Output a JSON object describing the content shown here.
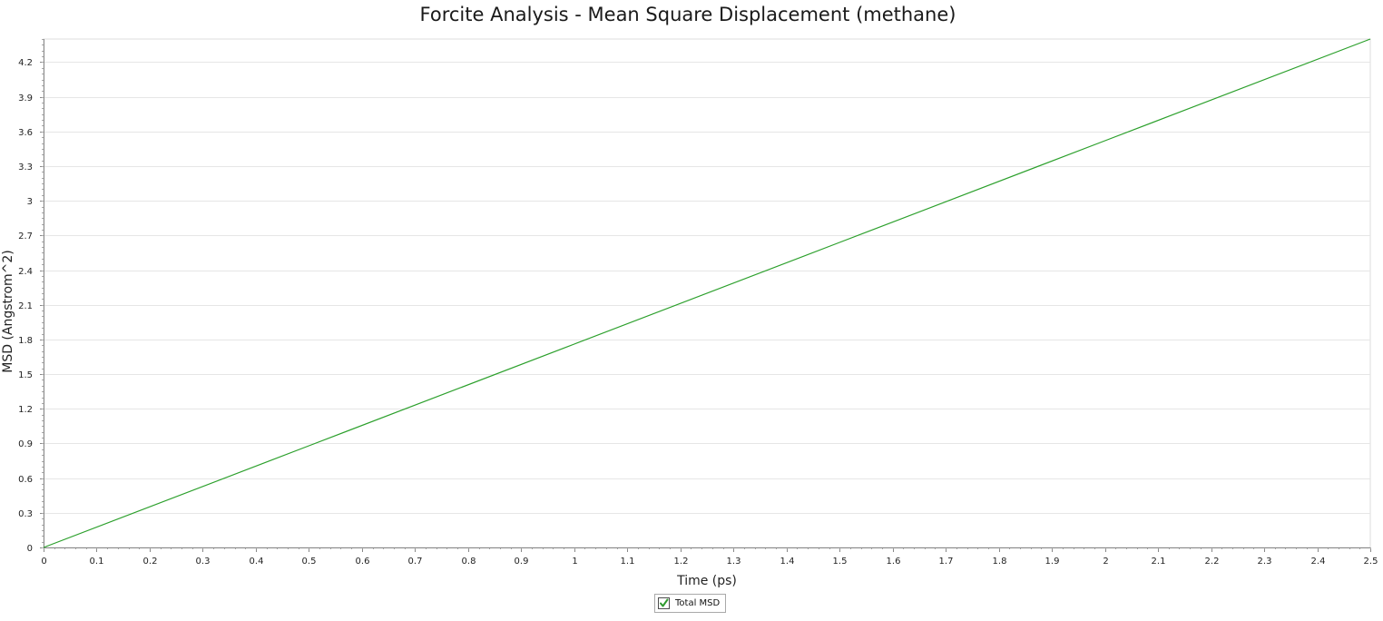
{
  "chart_data": {
    "type": "line",
    "title": "Forcite Analysis - Mean Square Displacement (methane)",
    "xlabel": "Time (ps)",
    "ylabel": "MSD (Angstrom^2)",
    "xlim": [
      0,
      2.5
    ],
    "ylim": [
      0,
      4.4
    ],
    "x_ticks": [
      "0",
      "0.1",
      "0.2",
      "0.3",
      "0.4",
      "0.5",
      "0.6",
      "0.7",
      "0.8",
      "0.9",
      "1",
      "1.1",
      "1.2",
      "1.3",
      "1.4",
      "1.5",
      "1.6",
      "1.7",
      "1.8",
      "1.9",
      "2",
      "2.1",
      "2.2",
      "2.3",
      "2.4",
      "2.5"
    ],
    "y_ticks": [
      "0",
      "0.3",
      "0.6",
      "0.9",
      "1.2",
      "1.5",
      "1.8",
      "2.1",
      "2.4",
      "2.7",
      "3",
      "3.3",
      "3.6",
      "3.9",
      "4.2"
    ],
    "grid": true,
    "legend_position": "bottom-center",
    "series": [
      {
        "name": "Total MSD",
        "color": "#2ca02c",
        "x": [
          0,
          0.5,
          1.0,
          1.5,
          2.0,
          2.5
        ],
        "y": [
          0,
          0.88,
          1.76,
          2.64,
          3.52,
          4.4
        ]
      }
    ]
  },
  "legend": {
    "items": [
      {
        "label": "Total MSD",
        "checked": true,
        "icon": "checkbox-checked-icon",
        "check_color": "#2e9a2e"
      }
    ]
  }
}
